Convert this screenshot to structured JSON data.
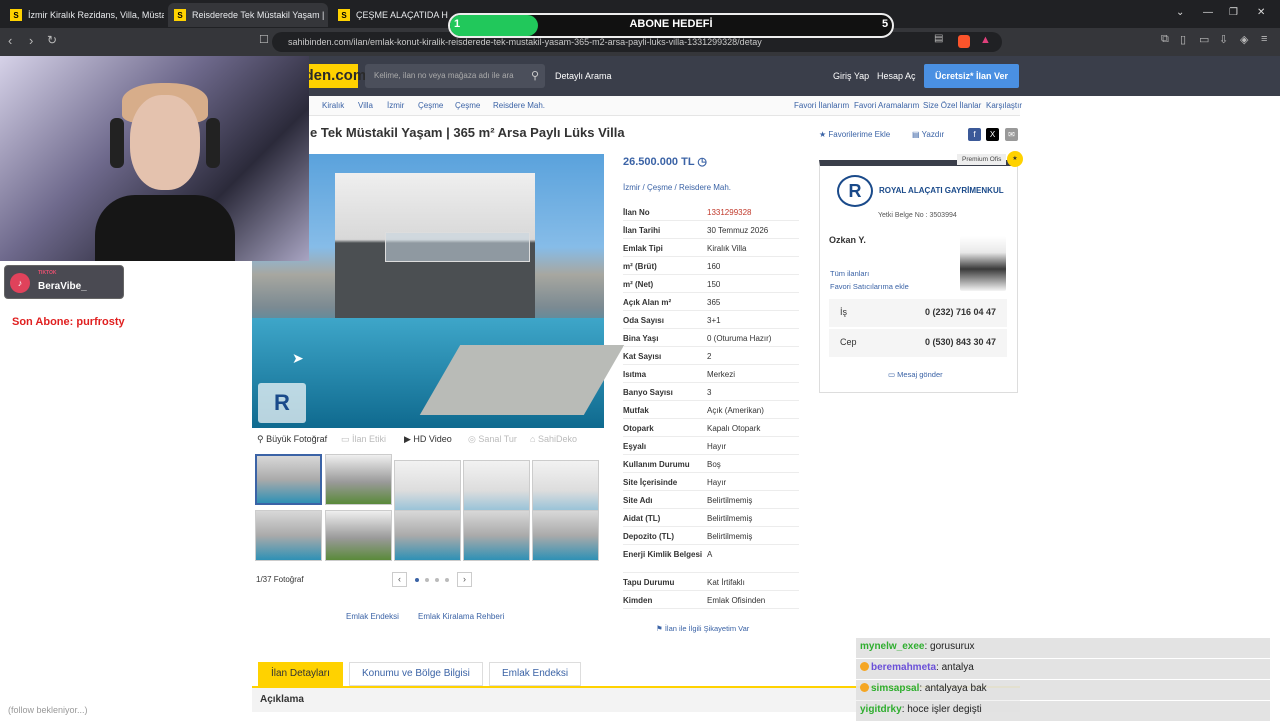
{
  "browser": {
    "tabs": [
      {
        "title": "İzmir Kiralık Rezidans, Villa, Müstakil"
      },
      {
        "title": "Reisderede Tek Müstakil Yaşam |"
      },
      {
        "title": "ÇEŞME ALAÇATIDA HAVUZLU SİTE İ"
      }
    ],
    "url": "sahibinden.com/ilan/emlak-konut-kiralik-reisderede-tek-mustakil-yasam-365-m2-arsa-payli-luks-villa-1331299328/detay"
  },
  "site": {
    "logo": "sahibinden.com",
    "search_placeholder": "Kelime, ilan no veya mağaza adı ile ara",
    "detailed_search": "Detaylı Arama",
    "login": "Giriş Yap",
    "register": "Hesap Aç",
    "post_ad": "Ücretsiz* İlan Ver",
    "breadcrumb": [
      "Kiralık",
      "Villa",
      "İzmir",
      "Çeşme",
      "Çeşme",
      "Reisdere Mah."
    ],
    "right_links": [
      "Favori İlanlarım",
      "Favori Aramalarım",
      "Size Özel İlanlar",
      "Karşılaştır"
    ]
  },
  "listing": {
    "title": "e Tek Müstakil Yaşam | 365 m² Arsa Paylı Lüks Villa",
    "fav": "Favorilerime Ekle",
    "print": "Yazdır",
    "price": "26.500.000 TL",
    "location": "İzmir  /  Çeşme  /  Reisdere Mah.",
    "photo_buttons": [
      "Büyük Fotoğraf",
      "İlan Etiki",
      "HD Video",
      "Sanal Tur",
      "SahiDeko"
    ],
    "photo_count": "1/37 Fotoğraf",
    "details": [
      {
        "k": "İlan No",
        "v": "1331299328"
      },
      {
        "k": "İlan Tarihi",
        "v": "30 Temmuz 2026"
      },
      {
        "k": "Emlak Tipi",
        "v": "Kiralık Villa"
      },
      {
        "k": "m² (Brüt)",
        "v": "160"
      },
      {
        "k": "m² (Net)",
        "v": "150"
      },
      {
        "k": "Açık Alan m²",
        "v": "365"
      },
      {
        "k": "Oda Sayısı",
        "v": "3+1"
      },
      {
        "k": "Bina Yaşı",
        "v": "0 (Oturuma Hazır)"
      },
      {
        "k": "Kat Sayısı",
        "v": "2"
      },
      {
        "k": "Isıtma",
        "v": "Merkezi"
      },
      {
        "k": "Banyo Sayısı",
        "v": "3"
      },
      {
        "k": "Mutfak",
        "v": "Açık (Amerikan)"
      },
      {
        "k": "Otopark",
        "v": "Kapalı Otopark"
      },
      {
        "k": "Eşyalı",
        "v": "Hayır"
      },
      {
        "k": "Kullanım Durumu",
        "v": "Boş"
      },
      {
        "k": "Site İçerisinde",
        "v": "Hayır"
      },
      {
        "k": "Site Adı",
        "v": "Belirtilmemiş"
      },
      {
        "k": "Aidat (TL)",
        "v": "Belirtilmemiş"
      },
      {
        "k": "Depozito (TL)",
        "v": "Belirtilmemiş"
      },
      {
        "k": "Enerji Kimlik Belgesi",
        "v": "A"
      },
      {
        "k": "Tapu Durumu",
        "v": "Kat İrtifaklı"
      },
      {
        "k": "Kimden",
        "v": "Emlak Ofisinden"
      }
    ],
    "complain": "İlan ile İlgili Şikayetim Var",
    "endex_links": [
      "Emlak Endeksi",
      "Emlak Kiralama Rehberi"
    ],
    "tabs": [
      "İlan Detayları",
      "Konumu ve Bölge Bilgisi",
      "Emlak Endeksi"
    ],
    "description_header": "Açıklama"
  },
  "agent": {
    "premium": "Premium Ofis",
    "name": "ROYAL ALAÇATI GAYRİMENKUL",
    "license": "Yetki Belge No : 3503994",
    "person": "Ozkan Y.",
    "all_ads": "Tüm ilanları",
    "fav_seller": "Favori Satıcılarıma ekle",
    "phones": [
      {
        "k": "İş",
        "v": "0 (232) 716 04 47"
      },
      {
        "k": "Cep",
        "v": "0 (530) 843 30 47"
      }
    ],
    "message": "Mesaj gönder"
  },
  "stream": {
    "goal_title": "ABONE HEDEFİ",
    "goal_current": "1",
    "goal_target": "5",
    "goal_progress": 0.2,
    "badge_small": "TIKTOK",
    "badge_name": "BeraVibe_",
    "last_sub": "Son Abone: purfrosty",
    "follow": "(follow bekleniyor...)",
    "chat": [
      {
        "user": "mynelw_exee",
        "msg": ": gorusurux",
        "color": "#2fae2f"
      },
      {
        "user": "beremahmeta",
        "msg": ": antalya",
        "color": "#6a4fd8"
      },
      {
        "user": "simsapsal",
        "msg": ": antalyaya bak",
        "color": "#2fae2f"
      },
      {
        "user": "yigitdrky",
        "msg": ": hoce işler degişti",
        "color": "#2fae2f"
      }
    ]
  }
}
